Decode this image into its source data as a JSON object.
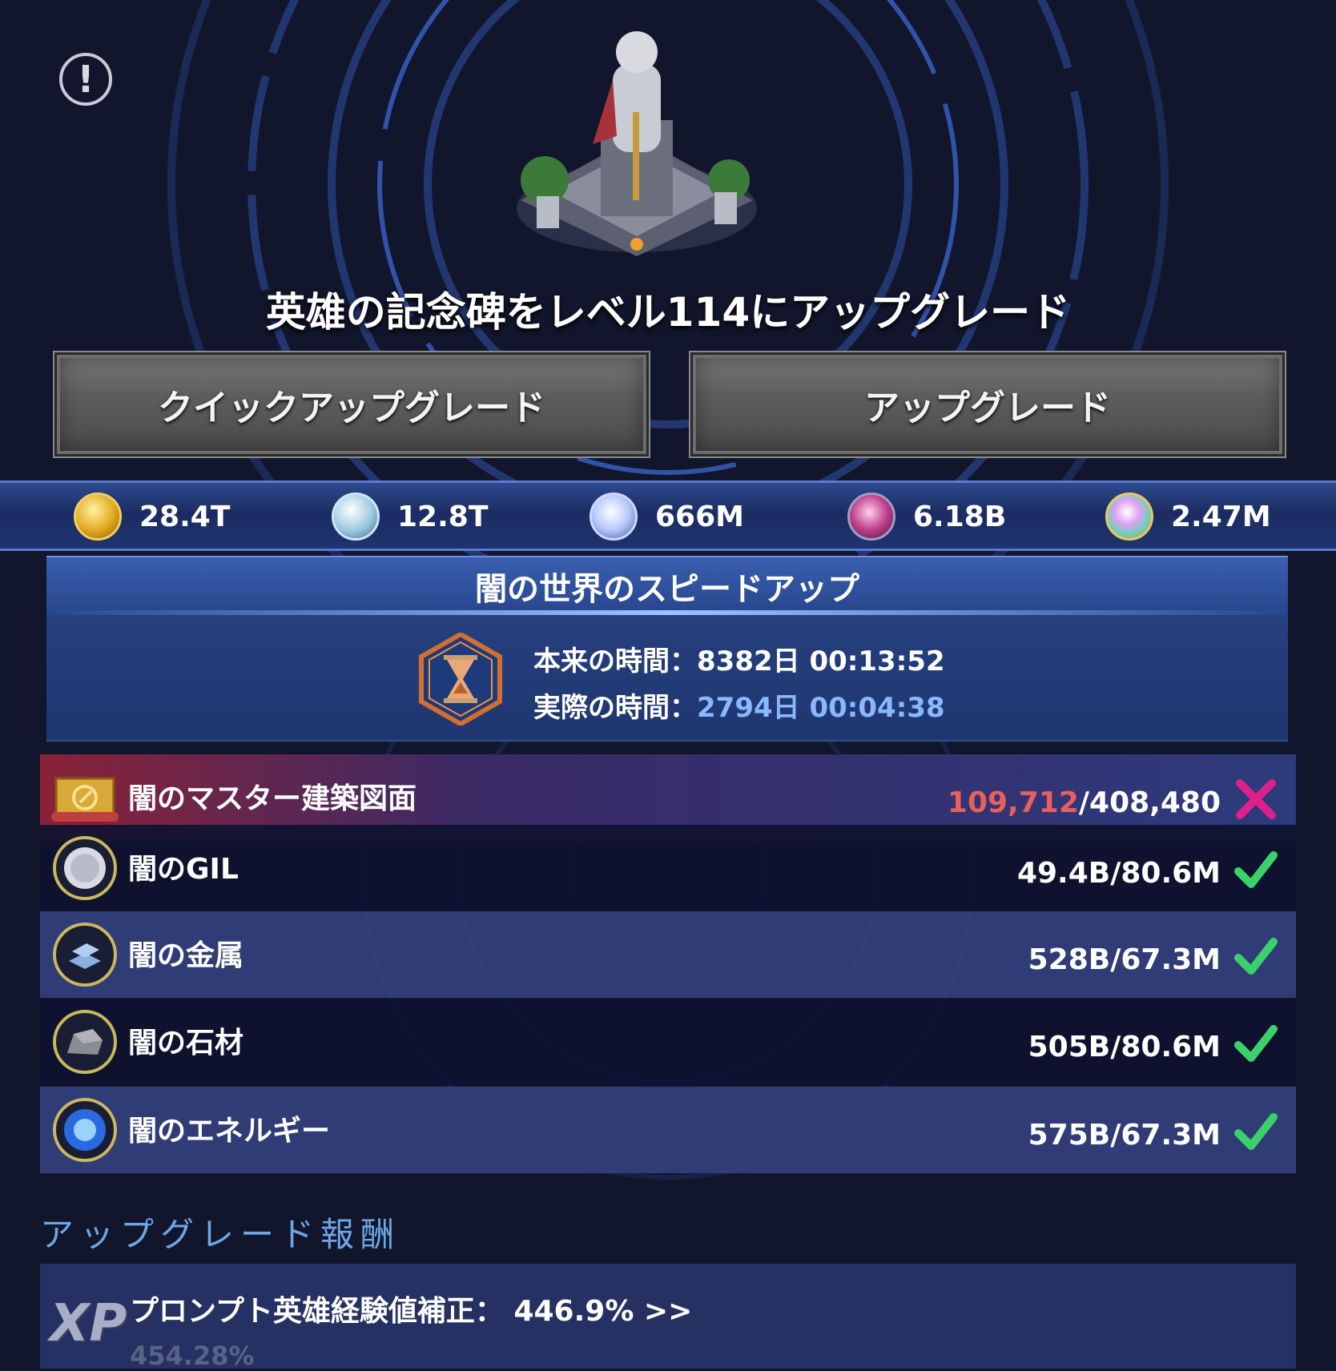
{
  "title": "英雄の記念碑をレベル114にアップグレード",
  "buttons": {
    "quick_upgrade": "クイックアップグレード",
    "upgrade": "アップグレード"
  },
  "resources": [
    {
      "icon": "gold-coin-icon",
      "value": "28.4T"
    },
    {
      "icon": "silver-coin-icon",
      "value": "12.8T"
    },
    {
      "icon": "diamond-gem-icon",
      "value": "666M"
    },
    {
      "icon": "purple-gem-icon",
      "value": "6.18B"
    },
    {
      "icon": "rainbow-gem-icon",
      "value": "2.47M"
    }
  ],
  "speedup": {
    "title": "闇の世界のスピードアップ",
    "original_label": "本来の時間：",
    "original_value": "8382日 00:13:52",
    "actual_label": "実際の時間：",
    "actual_value": "2794日 00:04:38"
  },
  "requirements": [
    {
      "name": "闇のマスター建築図面",
      "have": "109,712",
      "need": "/408,480",
      "met": false
    },
    {
      "name": "闇のGIL",
      "value": "49.4B/80.6M",
      "met": true
    },
    {
      "name": "闇の金属",
      "value": "528B/67.3M",
      "met": true
    },
    {
      "name": "闇の石材",
      "value": "505B/80.6M",
      "met": true
    },
    {
      "name": "闇のエネルギー",
      "value": "575B/67.3M",
      "met": true
    }
  ],
  "rewards": {
    "title": "アップグレード報酬",
    "icon_label": "XP",
    "text": "プロンプト英雄経験値補正： 446.9% >>",
    "next": "454.28%"
  },
  "colors": {
    "background": "#12162c",
    "accent": "#3a5fae",
    "success": "#3bd16a",
    "fail": "#e8605a"
  }
}
